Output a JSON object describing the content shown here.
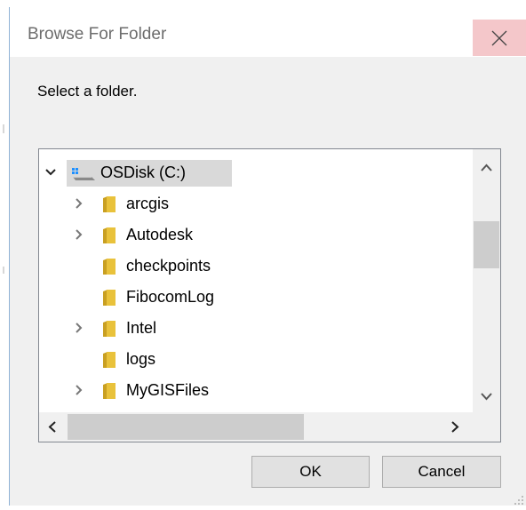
{
  "dialog": {
    "title": "Browse For Folder",
    "instruction": "Select a folder.",
    "close_icon": "close-icon"
  },
  "tree": {
    "root": {
      "label": "OSDisk (C:)",
      "expanded": true,
      "selected": true,
      "icon": "drive-icon"
    },
    "items": [
      {
        "label": "arcgis",
        "has_children": true
      },
      {
        "label": "Autodesk",
        "has_children": true
      },
      {
        "label": "checkpoints",
        "has_children": false
      },
      {
        "label": "FibocomLog",
        "has_children": false
      },
      {
        "label": "Intel",
        "has_children": true
      },
      {
        "label": "logs",
        "has_children": false
      },
      {
        "label": "MyGISFiles",
        "has_children": true
      }
    ]
  },
  "buttons": {
    "ok_label": "OK",
    "cancel_label": "Cancel"
  },
  "colors": {
    "folder": "#e9c23b",
    "selection": "#d9d9d9",
    "close_hover": "#f4c7ca",
    "drive_accent": "#1e90ff"
  }
}
